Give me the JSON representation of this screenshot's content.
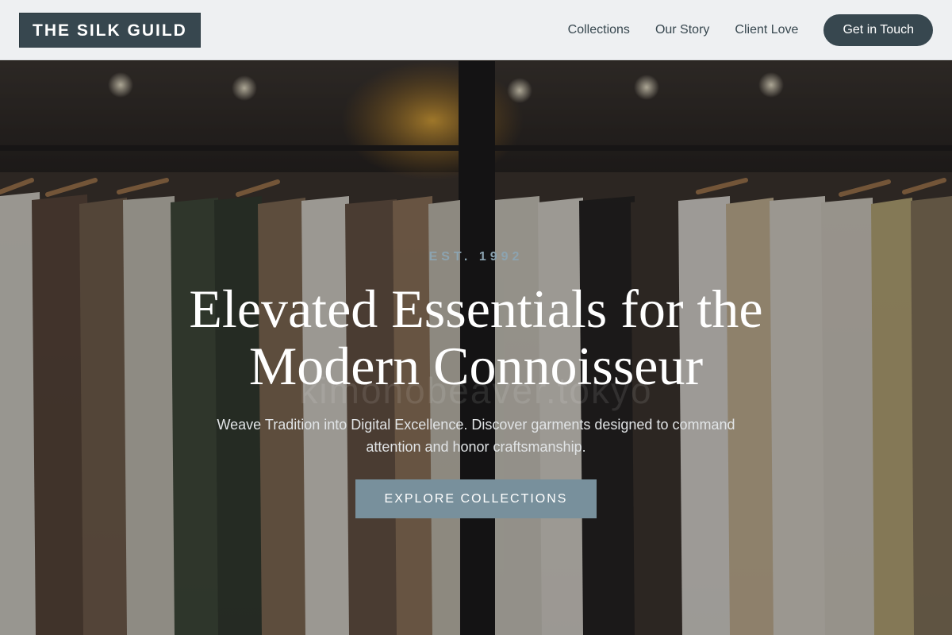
{
  "brand": {
    "name": "THE SILK GUILD"
  },
  "nav": {
    "links": [
      "Collections",
      "Our Story",
      "Client Love"
    ],
    "cta": "Get in Touch"
  },
  "hero": {
    "eyebrow": "EST. 1992",
    "headline_line1": "Elevated Essentials for the",
    "headline_line2": "Modern Connoisseur",
    "watermark": "kimonobeaver.tokyo",
    "subtitle_line1": "Weave Tradition into Digital Excellence. Discover garments designed to command",
    "subtitle_line2": "attention and honor craftsmanship.",
    "button": "EXPLORE COLLECTIONS"
  },
  "colors": {
    "primary": "#37474f",
    "accent": "#78909c",
    "header_bg": "#eef0f2"
  },
  "background_image": "clothing-rack-boutique-photo"
}
